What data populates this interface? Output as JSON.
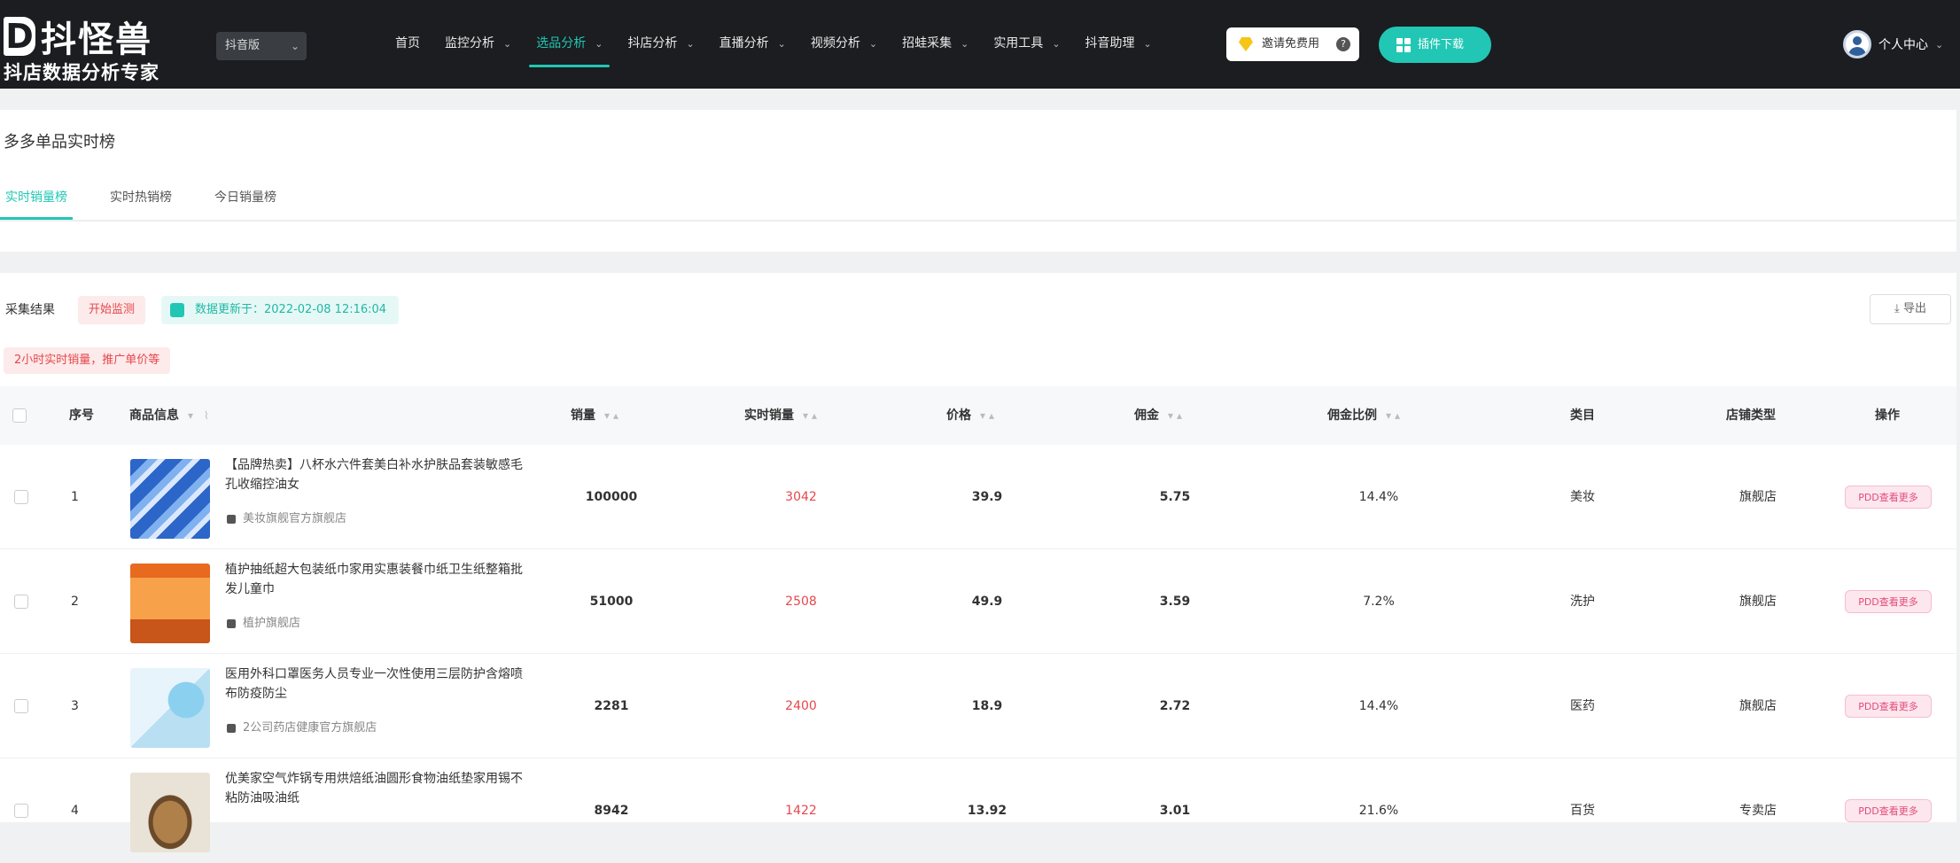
{
  "header": {
    "logo_name": "抖怪兽",
    "logo_tagline": "抖店数据分析专家",
    "platform_select": "抖音版",
    "nav": [
      {
        "label": "首页",
        "dropdown": false,
        "active": false
      },
      {
        "label": "监控分析",
        "dropdown": true,
        "active": false
      },
      {
        "label": "选品分析",
        "dropdown": true,
        "active": true
      },
      {
        "label": "抖店分析",
        "dropdown": true,
        "active": false
      },
      {
        "label": "直播分析",
        "dropdown": true,
        "active": false
      },
      {
        "label": "视频分析",
        "dropdown": true,
        "active": false
      },
      {
        "label": "招蛙采集",
        "dropdown": true,
        "active": false
      },
      {
        "label": "实用工具",
        "dropdown": true,
        "active": false
      },
      {
        "label": "抖音助理",
        "dropdown": true,
        "active": false
      }
    ],
    "invite_label": "邀请免费用",
    "plugin_label": "插件下载",
    "user_label": "个人中心",
    "accent_color": "#21c7b4"
  },
  "page": {
    "title": "多多单品实时榜",
    "tabs": [
      "实时销量榜",
      "实时热销榜",
      "今日销量榜"
    ],
    "active_tab": 0
  },
  "toolbar": {
    "label": "采集结果",
    "tag": "开始监测",
    "update_text": "数据更新于：2022-02-08 12:16:04",
    "export_label": "导出",
    "notice": "2小时实时销量，推广单价等"
  },
  "table": {
    "columns": {
      "index": "序号",
      "product": "商品信息",
      "sales": "销量",
      "realtime_sales": "实时销量",
      "price": "价格",
      "commission": "佣金",
      "commission_rate": "佣金比例",
      "category": "类目",
      "store_type": "店铺类型",
      "action": "操作"
    },
    "rows": [
      {
        "index": "1",
        "title": "【品牌热卖】八杯水六件套美白补水护肤品套装敏感毛孔收缩控油女",
        "shop": "美妆旗舰官方旗舰店",
        "sales": "100000",
        "realtime_sales": "3042",
        "price": "39.9",
        "commission": "5.75",
        "commission_rate": "14.4%",
        "category": "美妆",
        "store_type": "旗舰店",
        "action": "PDD查看更多"
      },
      {
        "index": "2",
        "title": "植护抽纸超大包装纸巾家用实惠装餐巾纸卫生纸整箱批发儿童巾",
        "shop": "植护旗舰店",
        "sales": "51000",
        "realtime_sales": "2508",
        "price": "49.9",
        "commission": "3.59",
        "commission_rate": "7.2%",
        "category": "洗护",
        "store_type": "旗舰店",
        "action": "PDD查看更多"
      },
      {
        "index": "3",
        "title": "医用外科口罩医务人员专业一次性使用三层防护含熔喷布防疫防尘",
        "shop": "2公司药店健康官方旗舰店",
        "sales": "2281",
        "realtime_sales": "2400",
        "price": "18.9",
        "commission": "2.72",
        "commission_rate": "14.4%",
        "category": "医药",
        "store_type": "旗舰店",
        "action": "PDD查看更多"
      },
      {
        "index": "4",
        "title": "优美家空气炸锅专用烘焙纸油圆形食物油纸垫家用锡不粘防油吸油纸",
        "shop": "",
        "sales": "8942",
        "realtime_sales": "1422",
        "price": "13.92",
        "commission": "3.01",
        "commission_rate": "21.6%",
        "category": "百货",
        "store_type": "专卖店",
        "action": "PDD查看更多"
      }
    ]
  }
}
